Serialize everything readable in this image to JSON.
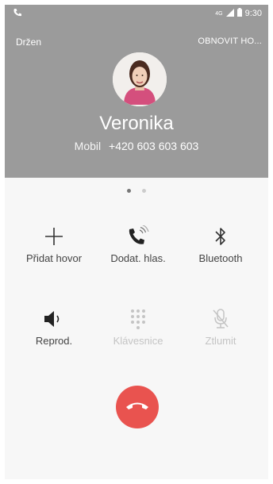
{
  "status_bar": {
    "time": "9:30"
  },
  "header": {
    "hold_label": "Držen",
    "resume_label": "OBNOVIT HO..."
  },
  "contact": {
    "name": "Veronika",
    "number_type": "Mobil",
    "number": "+420 603 603 603"
  },
  "pager": {
    "count": 2,
    "active": 0
  },
  "actions": [
    {
      "label": "Přidat hovor",
      "icon": "plus-icon",
      "enabled": true
    },
    {
      "label": "Dodat. hlas.",
      "icon": "phone-volume-icon",
      "enabled": true
    },
    {
      "label": "Bluetooth",
      "icon": "bluetooth-icon",
      "enabled": true
    },
    {
      "label": "Reprod.",
      "icon": "speaker-icon",
      "enabled": true
    },
    {
      "label": "Klávesnice",
      "icon": "keypad-icon",
      "enabled": false
    },
    {
      "label": "Ztlumit",
      "icon": "mute-mic-icon",
      "enabled": false
    }
  ],
  "colors": {
    "header_bg": "#9b9b9b",
    "end_call": "#e9534f",
    "label": "#444444",
    "disabled": "#c4c4c4"
  }
}
